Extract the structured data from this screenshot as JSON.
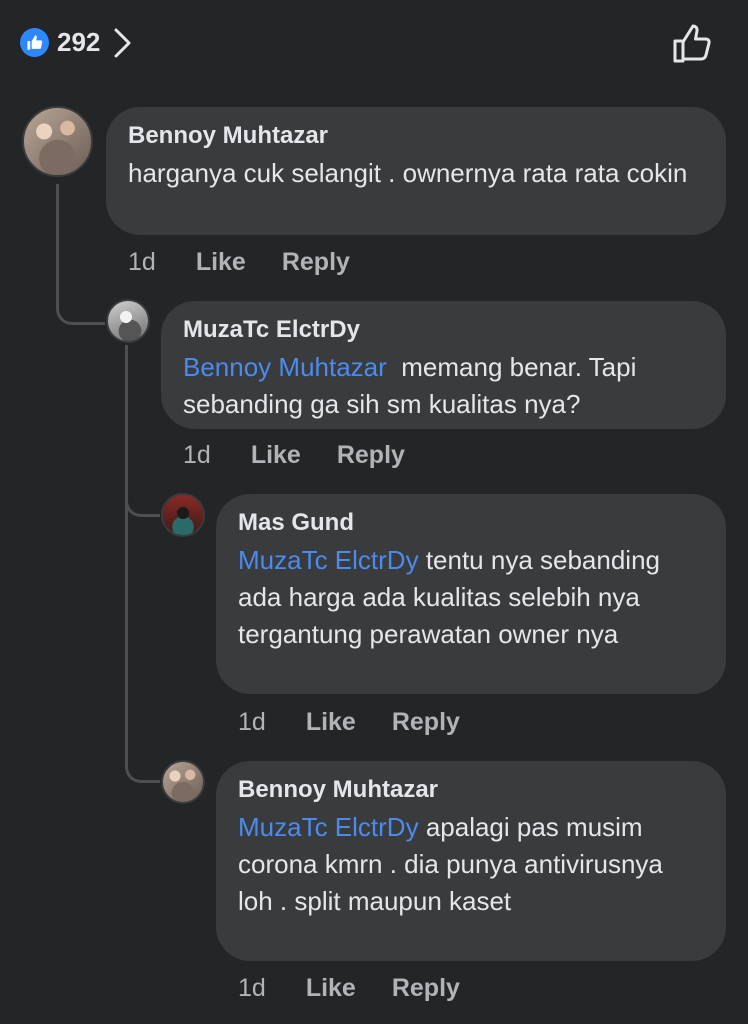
{
  "header": {
    "reaction_count": "292",
    "colors": {
      "accent": "#2d88ff",
      "background": "#242526",
      "bubble": "#3a3b3c",
      "mention": "#4b8bf0",
      "muted": "#b0b3b8"
    }
  },
  "comments": [
    {
      "author": "Bennoy Muhtazar",
      "mention": "",
      "text": "harganya cuk selangit . ownernya rata rata cokin",
      "time": "1d",
      "like": "Like",
      "reply": "Reply"
    },
    {
      "author": "MuzaTc ElctrDy",
      "mention": "Bennoy Muhtazar",
      "text": "memang benar. Tapi sebanding ga sih sm kualitas nya?",
      "time": "1d",
      "like": "Like",
      "reply": "Reply"
    },
    {
      "author": "Mas Gund",
      "mention": "MuzaTc ElctrDy",
      "text": "tentu nya sebanding ada harga ada kualitas selebih nya tergantung perawatan owner nya",
      "time": "1d",
      "like": "Like",
      "reply": "Reply"
    },
    {
      "author": "Bennoy Muhtazar",
      "mention": "MuzaTc ElctrDy",
      "text": "apalagi pas musim corona kmrn . dia punya antivirusnya loh . split maupun kaset",
      "time": "1d",
      "like": "Like",
      "reply": "Reply"
    }
  ]
}
